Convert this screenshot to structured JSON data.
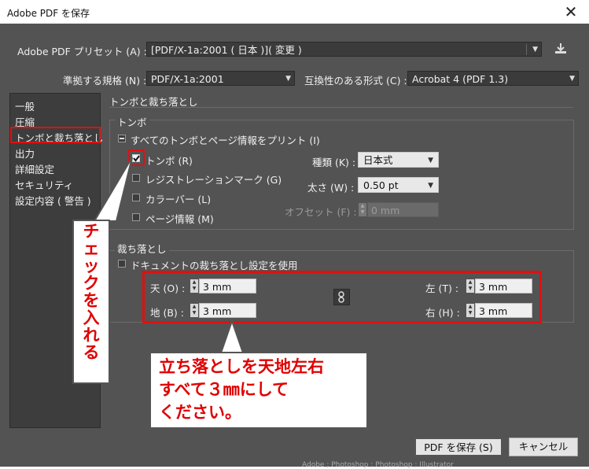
{
  "window": {
    "title": "Adobe PDF を保存",
    "close_glyph": "✕"
  },
  "preset": {
    "label": "Adobe PDF プリセット (A) :",
    "value": "[PDF/X-1a:2001 ( 日本 )]( 変更 )"
  },
  "standard": {
    "label": "準拠する規格 (N) :",
    "value": "PDF/X-1a:2001"
  },
  "compat": {
    "label": "互換性のある形式 (C) :",
    "value": "Acrobat 4 (PDF 1.3)"
  },
  "sidebar": {
    "items": [
      {
        "label": "一般"
      },
      {
        "label": "圧縮"
      },
      {
        "label": "トンボと裁ち落とし"
      },
      {
        "label": "出力"
      },
      {
        "label": "詳細設定"
      },
      {
        "label": "セキュリティ"
      },
      {
        "label": "設定内容 ( 警告 )"
      }
    ]
  },
  "section_title": "トンボと裁ち落とし",
  "marks": {
    "group_title": "トンボ",
    "print_all": "すべてのトンボとページ情報をプリント (I)",
    "trim_marks": "トンボ (R)",
    "registration": "レジストレーションマーク (G)",
    "color_bars": "カラーバー (L)",
    "page_info": "ページ情報 (M)",
    "type_label": "種類 (K) :",
    "type_value": "日本式",
    "weight_label": "太さ (W) :",
    "weight_value": "0.50 pt",
    "offset_label": "オフセット (F) :",
    "offset_value": "0 mm"
  },
  "bleed": {
    "group_title": "裁ち落とし",
    "use_doc": "ドキュメントの裁ち落とし設定を使用",
    "top_label": "天 (O) :",
    "top_value": "3 mm",
    "bottom_label": "地 (B) :",
    "bottom_value": "3 mm",
    "left_label": "左 (T) :",
    "left_value": "3 mm",
    "right_label": "右 (H) :",
    "right_value": "3 mm"
  },
  "buttons": {
    "save": "PDF を保存 (S)",
    "cancel": "キャンセル"
  },
  "annotations": {
    "check_note": "チェックを入れる",
    "bleed_note": [
      "立ち落としを天地左右",
      "すべて３㎜にして",
      "ください。"
    ]
  },
  "background_text": "Adobe ; Photoshop ; Photoshop ; Illustrator",
  "colors": {
    "dialog_bg": "#535353",
    "panel_bg": "#3d3d3d",
    "annotation_red": "#e01010"
  }
}
